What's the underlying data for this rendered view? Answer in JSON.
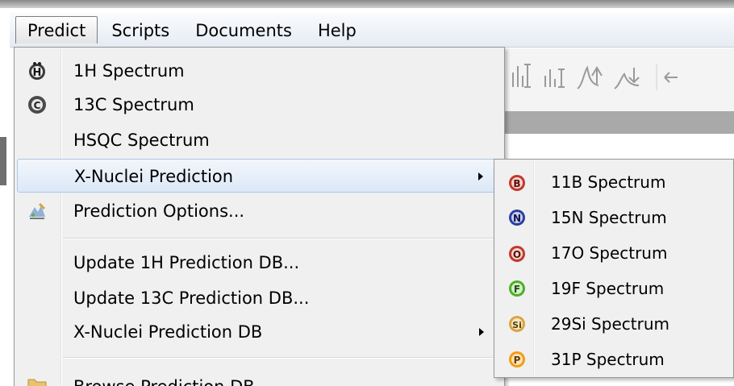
{
  "menubar": {
    "items": [
      "Predict",
      "Scripts",
      "Documents",
      "Help"
    ],
    "active_index": 0
  },
  "predict_menu": {
    "items": [
      {
        "label": "1H Spectrum",
        "icon": "h-atom-icon"
      },
      {
        "label": "13C Spectrum",
        "icon": "c-atom-icon"
      },
      {
        "label": "HSQC Spectrum",
        "icon": ""
      },
      {
        "label": "X-Nuclei Prediction",
        "icon": "",
        "submenu": true,
        "highlighted": true
      },
      {
        "label": "Prediction Options...",
        "icon": "prediction-options-icon"
      },
      {
        "label": "Update 1H Prediction DB...",
        "icon": ""
      },
      {
        "label": "Update 13C Prediction DB...",
        "icon": ""
      },
      {
        "label": "X-Nuclei Prediction DB",
        "icon": "",
        "submenu": true
      },
      {
        "label": "Browse Prediction DB",
        "icon": "folder-icon"
      }
    ]
  },
  "x_nuclei_submenu": {
    "items": [
      {
        "label": "11B Spectrum",
        "badge": "B",
        "color": "#c0392b"
      },
      {
        "label": "15N Spectrum",
        "badge": "N",
        "color": "#2c3e9e"
      },
      {
        "label": "17O Spectrum",
        "badge": "O",
        "color": "#c0392b"
      },
      {
        "label": "19F Spectrum",
        "badge": "F",
        "color": "#4caf2a"
      },
      {
        "label": "29Si Spectrum",
        "badge": "Si",
        "color": "#d9a441"
      },
      {
        "label": "31P Spectrum",
        "badge": "P",
        "color": "#f39c12"
      }
    ]
  }
}
